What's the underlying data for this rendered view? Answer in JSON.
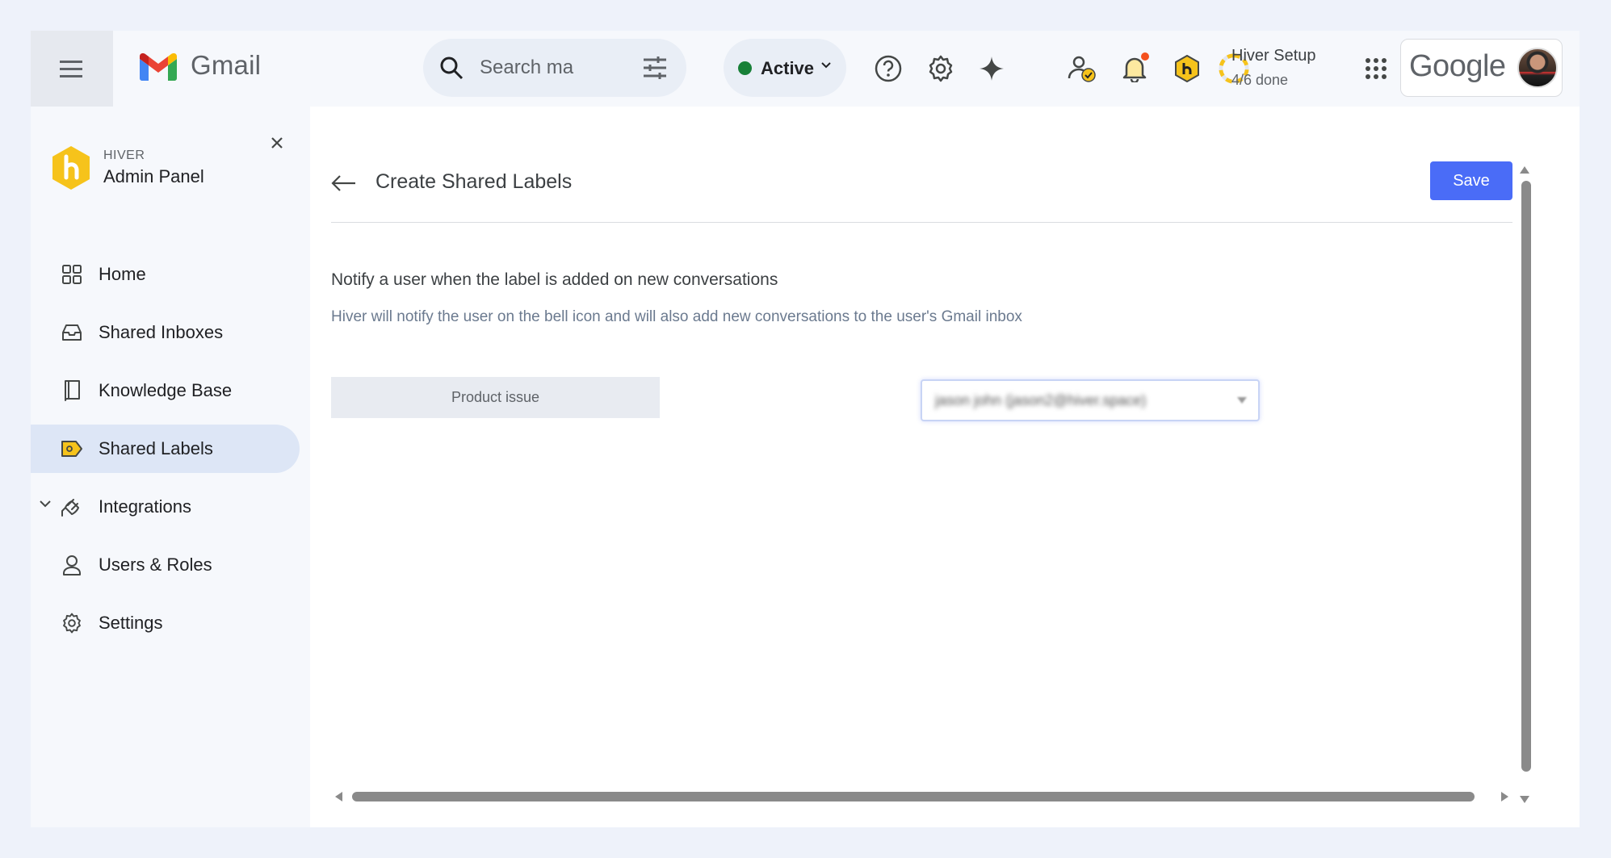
{
  "header": {
    "app_name": "Gmail",
    "search": {
      "placeholder": "Search ma"
    },
    "status": {
      "label": "Active",
      "color": "#188038"
    },
    "icons": [
      "menu-icon",
      "search-icon",
      "filter-icon",
      "help-icon",
      "settings-icon",
      "gemini-icon",
      "user-check-icon",
      "bell-icon",
      "hiver-icon",
      "progress-ring-icon",
      "apps-grid-icon"
    ],
    "hiver_setup": {
      "title": "Hiver Setup",
      "progress": "4/6 done",
      "completed": 4,
      "total": 6
    },
    "account": {
      "brand": "Google"
    }
  },
  "sidebar": {
    "brand_small": "HIVER",
    "brand_title": "Admin Panel",
    "items": [
      {
        "label": "Home",
        "icon": "grid-icon",
        "active": false
      },
      {
        "label": "Shared Inboxes",
        "icon": "inbox-icon",
        "active": false
      },
      {
        "label": "Knowledge Base",
        "icon": "book-icon",
        "active": false
      },
      {
        "label": "Shared Labels",
        "icon": "label-icon",
        "active": true
      },
      {
        "label": "Integrations",
        "icon": "plug-icon",
        "active": false,
        "expandable": true
      },
      {
        "label": "Users & Roles",
        "icon": "user-icon",
        "active": false
      },
      {
        "label": "Settings",
        "icon": "gear-icon",
        "active": false
      }
    ]
  },
  "main": {
    "title": "Create Shared Labels",
    "save_label": "Save",
    "section_title": "Notify a user when the label is added on new conversations",
    "section_desc": "Hiver will notify the user on the bell icon and will also add new conversations to the user's Gmail inbox",
    "label_name": "Product issue",
    "selected_user": "jason john (jason2@hiver.space)"
  },
  "colors": {
    "accent": "#4a6cf7",
    "active_nav": "#dde6f6",
    "hiver_yellow": "#f6c31b"
  }
}
